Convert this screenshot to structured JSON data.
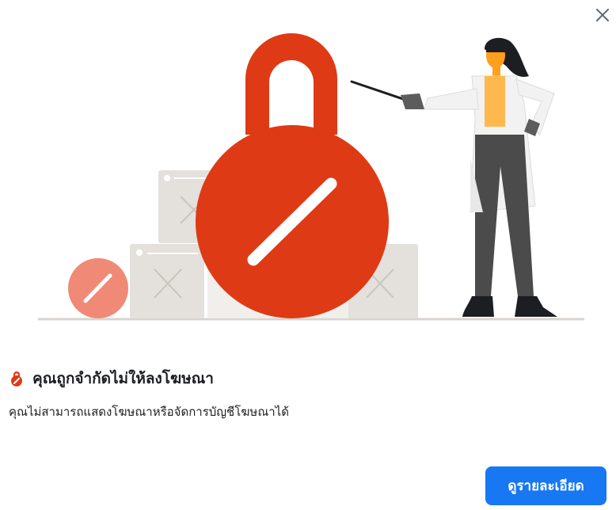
{
  "dialog": {
    "title": "คุณถูกจำกัดไม่ให้ลงโฆษณา",
    "description": "คุณไม่สามารถแสดงโฆษณาหรือจัดการบัญชีโฆษณาได้",
    "details_button": "ดูรายละเอียด",
    "close_icon": "close-icon",
    "title_icon": "restricted-lock-icon"
  },
  "colors": {
    "lock_red": "#de3a16",
    "lock_light": "#f08a76",
    "primary_button": "#1877f2",
    "box_gray": "#e4e1dc"
  }
}
